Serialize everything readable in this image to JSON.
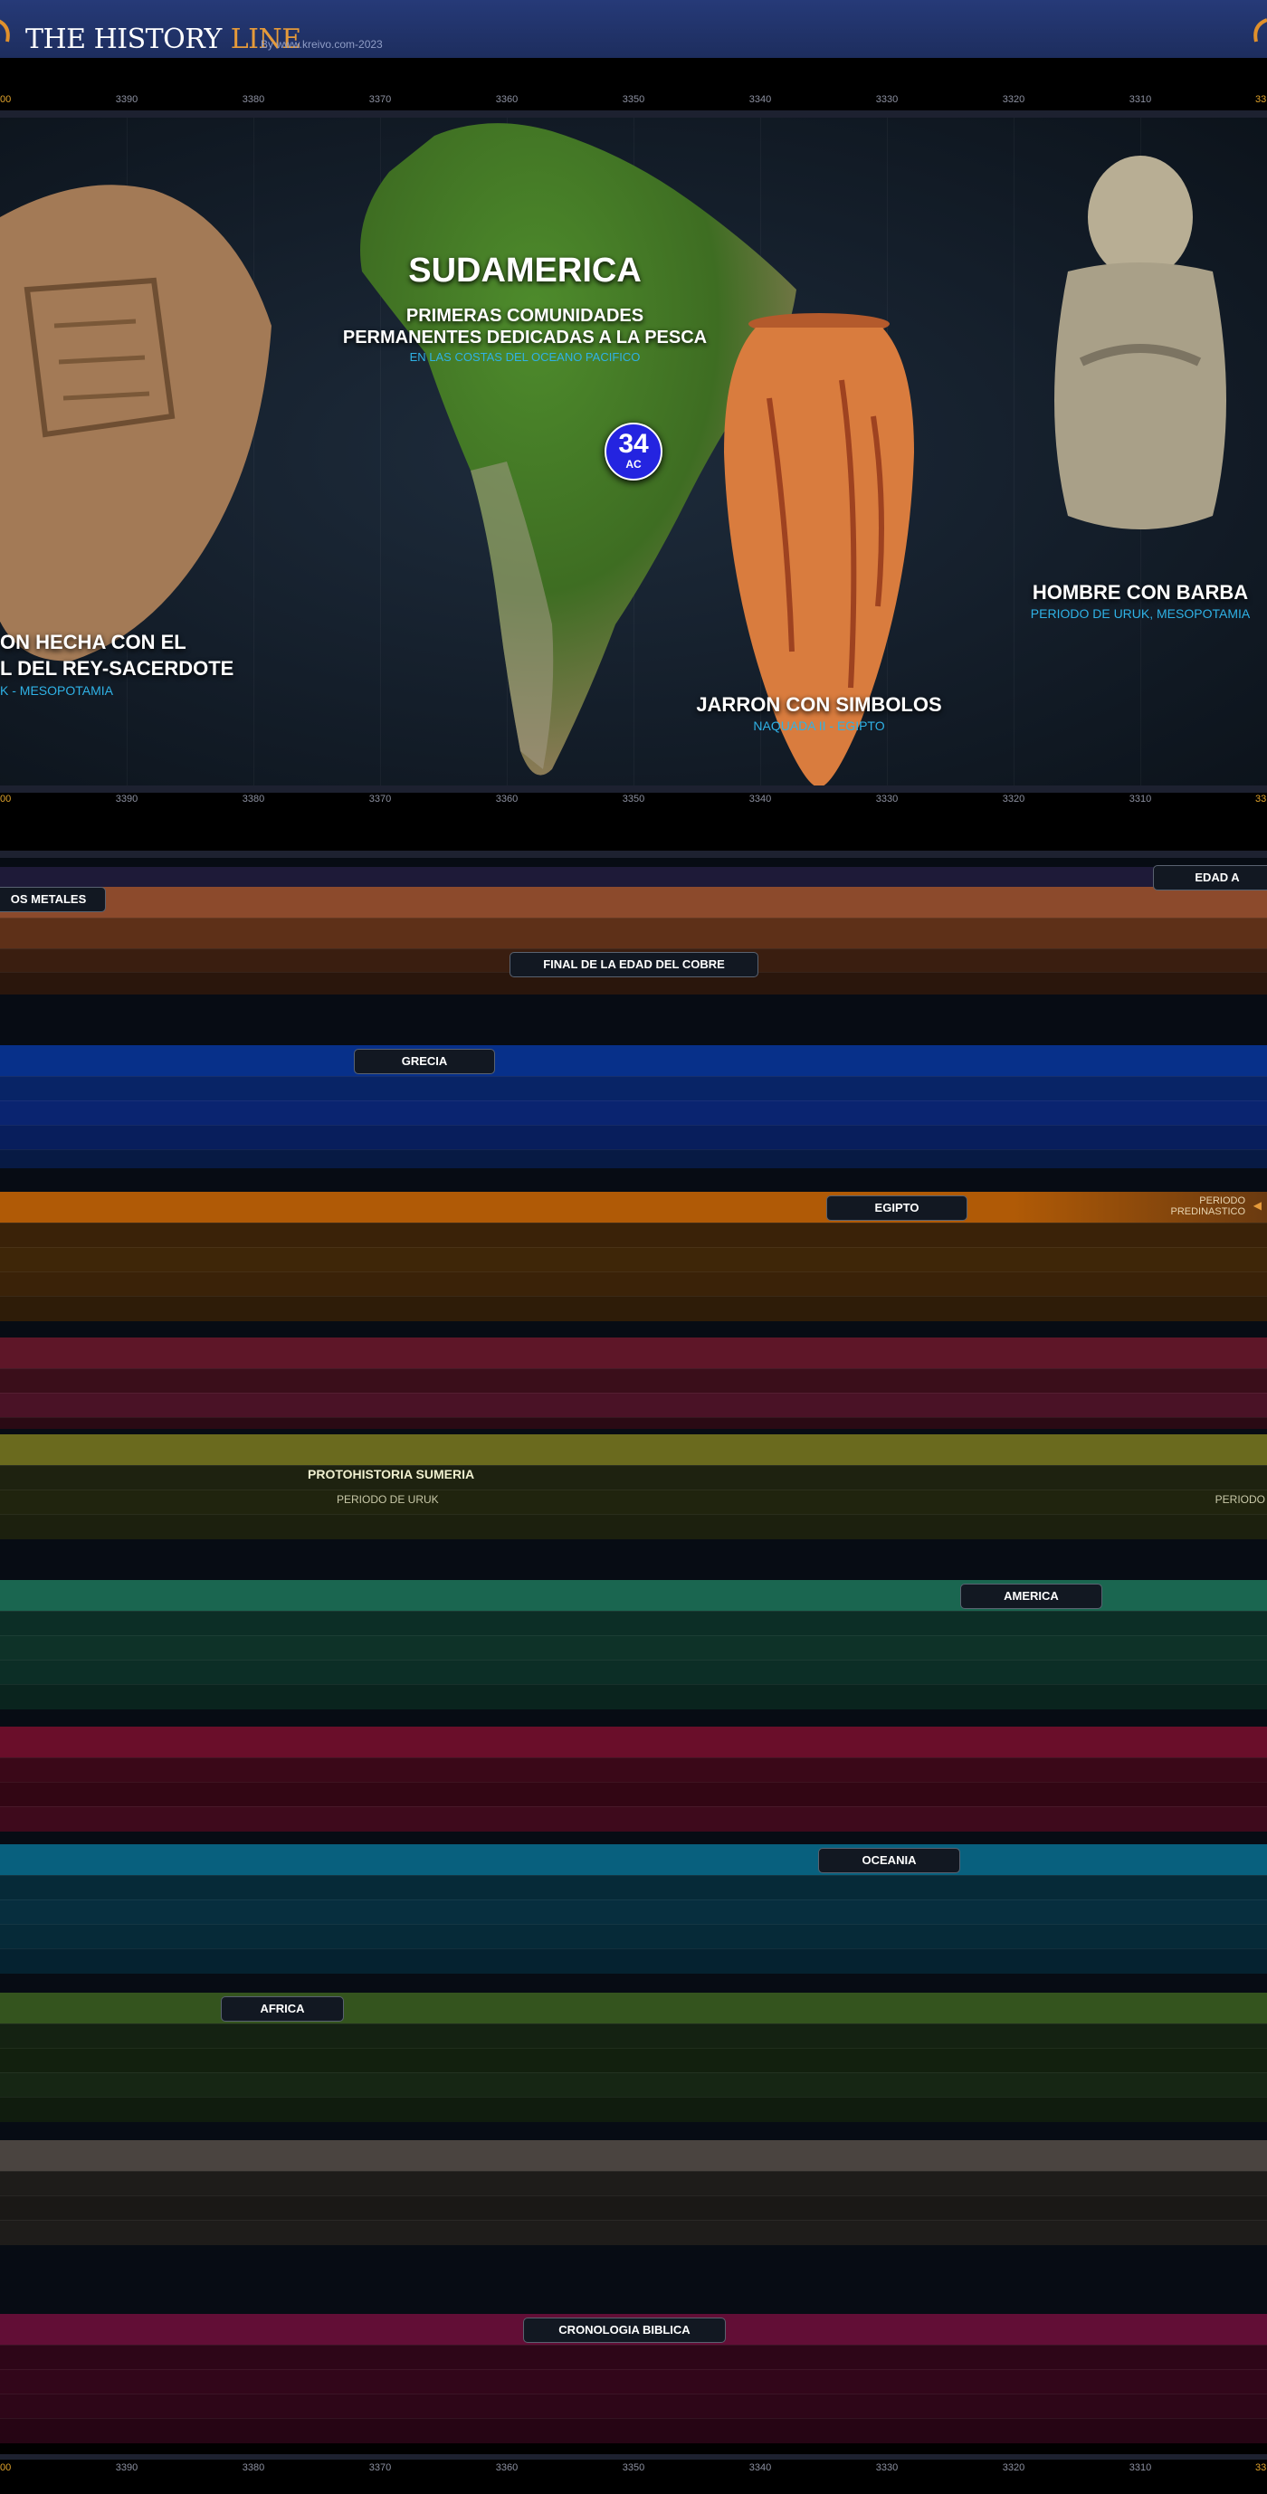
{
  "header": {
    "logo_main": "THE HISTORY",
    "logo_accent": "LINE",
    "byline": "By www.kreivo.com-2023"
  },
  "ruler": {
    "left_edge": "00",
    "right_edge": "33",
    "ticks": [
      "3390",
      "3380",
      "3370",
      "3360",
      "3350",
      "3340",
      "3330",
      "3320",
      "3310"
    ]
  },
  "hero": {
    "main": {
      "title": "SUDAMERICA",
      "subtitle_line1": "PRIMERAS COMUNIDADES",
      "subtitle_line2": "PERMANENTES DEDICADAS A LA PESCA",
      "caption": "EN LAS COSTAS DEL OCEANO PACIFICO"
    },
    "marker": {
      "number": "34",
      "unit": "AC"
    },
    "cards": [
      {
        "title_line1": "ON HECHA CON EL",
        "title_line2": "L DEL REY-SACERDOTE",
        "caption": "K - MESOPOTAMIA"
      },
      {
        "title": "JARRON CON SIMBOLOS",
        "caption": "NAQUADA II - EGIPTO"
      },
      {
        "title": "HOMBRE CON BARBA",
        "caption": "PERIODO DE URUK, MESOPOTAMIA"
      }
    ]
  },
  "timeline": {
    "edad_label": "EDAD A",
    "metales_label": "OS METALES",
    "cobre_label": "FINAL DE LA EDAD DEL COBRE",
    "grecia_label": "GRECIA",
    "egipto_label": "EGIPTO",
    "predinastico_line1": "PERIODO",
    "predinastico_line2": "PREDINASTICO",
    "sumeria_label": "PROTOHISTORIA SUMERIA",
    "uruk_label": "PERIODO DE URUK",
    "uruk_right": "PERIODO",
    "america_label": "AMERICA",
    "oceania_label": "OCEANIA",
    "africa_label": "AFRICA",
    "biblica_label": "CRONOLOGIA BIBLICA"
  },
  "colors": {
    "accent": "#e59a3a",
    "caption_blue": "#2fb2e6",
    "marker_blue": "#2424e0"
  }
}
